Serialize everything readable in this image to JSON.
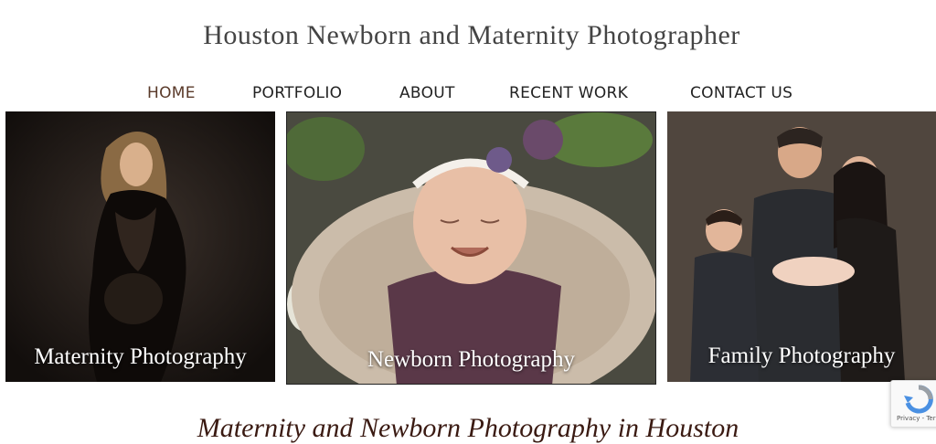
{
  "site": {
    "title": "Houston Newborn and Maternity Photographer"
  },
  "nav": {
    "items": [
      {
        "label": "HOME"
      },
      {
        "label": "PORTFOLIO"
      },
      {
        "label": "ABOUT"
      },
      {
        "label": "RECENT WORK"
      },
      {
        "label": "CONTACT US"
      }
    ]
  },
  "panels": [
    {
      "caption": "Maternity Photography"
    },
    {
      "caption": "Newborn Photography"
    },
    {
      "caption": "Family Photography"
    }
  ],
  "section": {
    "heading": "Maternity and Newborn Photography in Houston"
  },
  "recaptcha": {
    "links": "Privacy - Terms"
  },
  "colors": {
    "active_nav": "#5a3a2a",
    "heading": "#3a1a12"
  }
}
